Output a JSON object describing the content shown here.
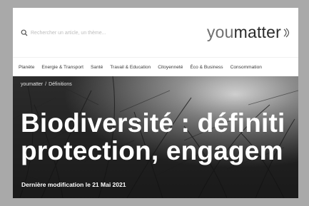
{
  "header": {
    "search_placeholder": "Rechercher un article, un thème...",
    "logo_light": "you",
    "logo_dark": "matter"
  },
  "nav": {
    "items": [
      "Planète",
      "Energie & Transport",
      "Santé",
      "Travail & Education",
      "Citoyenneté",
      "Éco & Business",
      "Consommation"
    ]
  },
  "hero": {
    "breadcrumb": [
      "youmatter",
      "Définitions"
    ],
    "title_line1": "Biodiversité : définiti",
    "title_line2": "protection, engagem",
    "updated": "Dernière modification le 21 Mai 2021"
  }
}
